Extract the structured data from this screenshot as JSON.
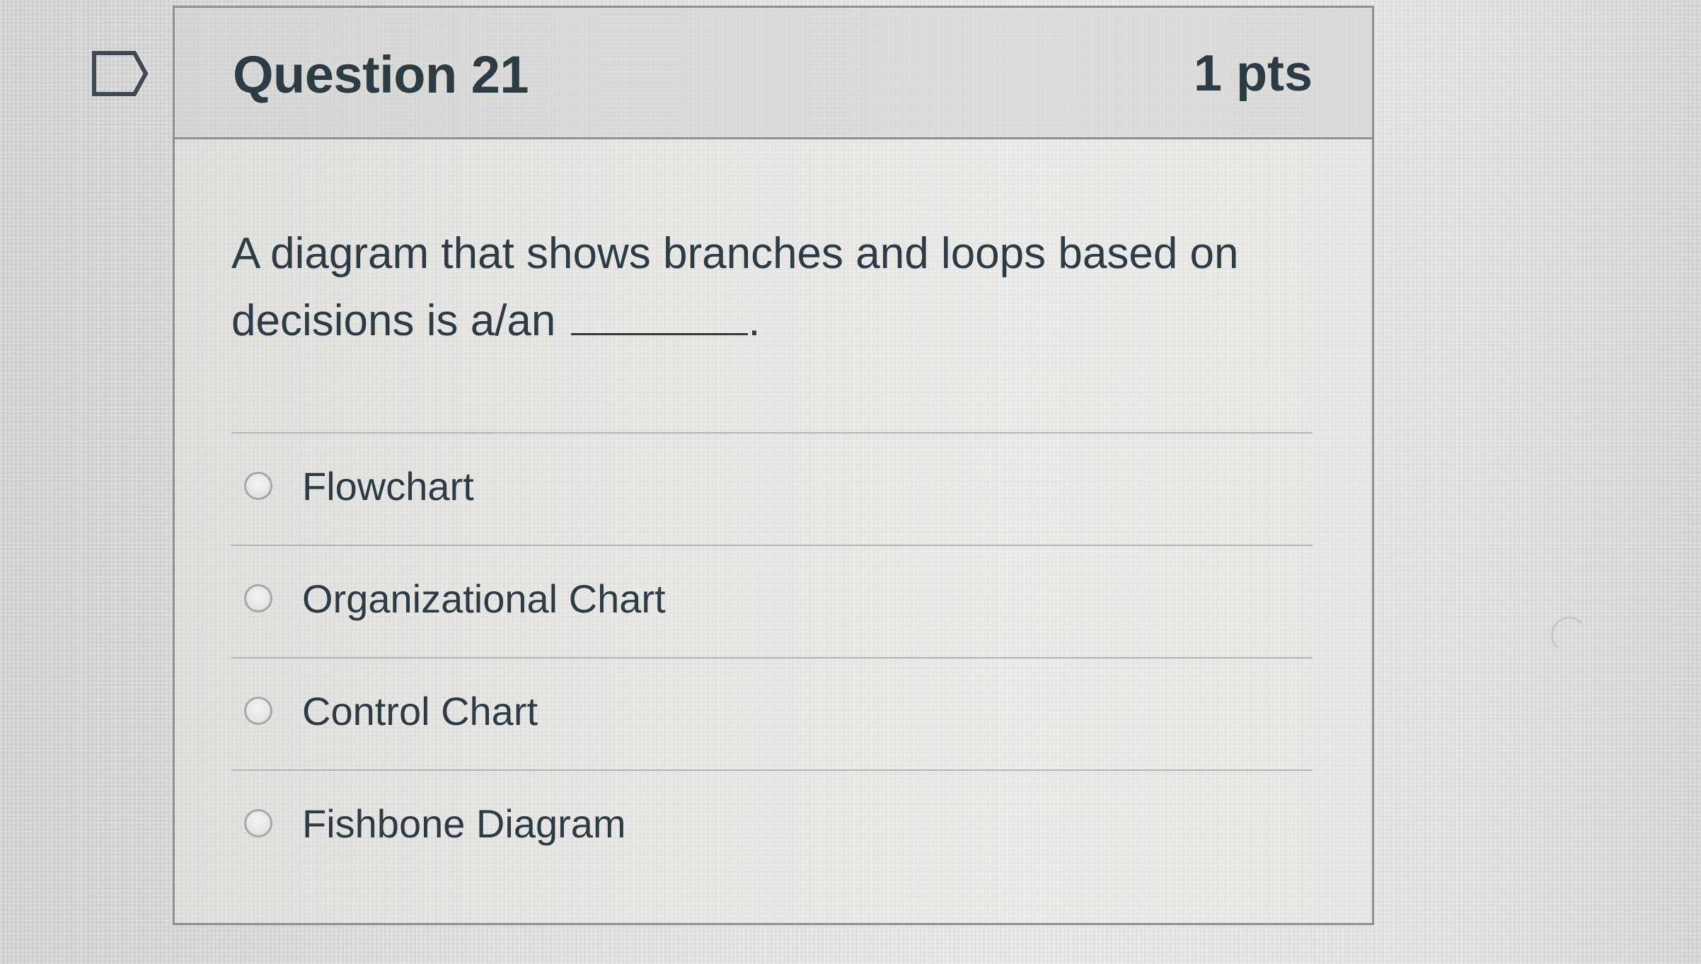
{
  "question": {
    "title": "Question 21",
    "points": "1 pts",
    "text": "A diagram that shows branches and loops based on decisions is a/an",
    "text_end": "."
  },
  "answers": [
    {
      "label": "Flowchart",
      "selected": false
    },
    {
      "label": "Organizational Chart",
      "selected": false
    },
    {
      "label": "Control Chart",
      "selected": false
    },
    {
      "label": "Fishbone Diagram",
      "selected": false
    }
  ],
  "icons": {
    "flag": "flag-question-icon",
    "radio": "radio-button-icon"
  },
  "colors": {
    "text": "#2d3b45",
    "border": "#8d9296",
    "divider": "#b3b6b8"
  }
}
